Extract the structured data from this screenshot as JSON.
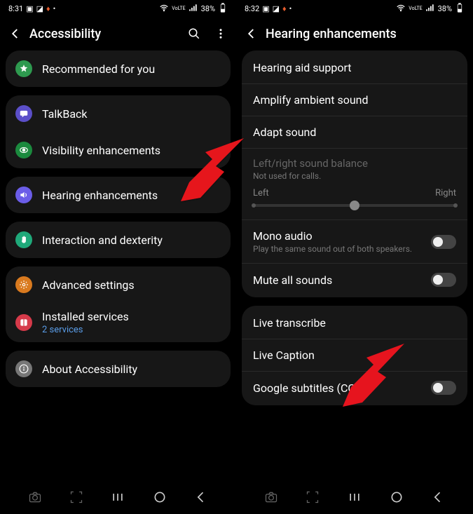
{
  "left": {
    "status": {
      "time": "8:31",
      "battery": "38%"
    },
    "title": "Accessibility",
    "groups": [
      [
        {
          "icon": "star",
          "color": "#2e9a4f",
          "label": "Recommended for you"
        }
      ],
      [
        {
          "icon": "chat",
          "color": "#5b4fc9",
          "label": "TalkBack"
        },
        {
          "icon": "eye",
          "color": "#1b8a3e",
          "label": "Visibility enhancements"
        }
      ],
      [
        {
          "icon": "speaker",
          "color": "#6b5de8",
          "label": "Hearing enhancements"
        }
      ],
      [
        {
          "icon": "hand",
          "color": "#1fa97a",
          "label": "Interaction and dexterity"
        }
      ],
      [
        {
          "icon": "gear",
          "color": "#d97a1f",
          "label": "Advanced settings"
        },
        {
          "icon": "box",
          "color": "#d63a4a",
          "label": "Installed services",
          "sub": "2 services"
        }
      ],
      [
        {
          "icon": "info",
          "color": "#777",
          "label": "About Accessibility"
        }
      ]
    ]
  },
  "right": {
    "status": {
      "time": "8:32",
      "battery": "38%"
    },
    "title": "Hearing enhancements",
    "card1": {
      "items": [
        {
          "label": "Hearing aid support"
        },
        {
          "label": "Amplify ambient sound"
        },
        {
          "label": "Adapt sound"
        }
      ],
      "balance": {
        "title": "Left/right sound balance",
        "sub": "Not used for calls.",
        "left": "Left",
        "right": "Right"
      },
      "mono": {
        "label": "Mono audio",
        "sub": "Play the same sound out of both speakers."
      },
      "mute": {
        "label": "Mute all sounds"
      }
    },
    "card2": {
      "items": [
        {
          "label": "Live transcribe"
        },
        {
          "label": "Live Caption"
        },
        {
          "label": "Google subtitles (CC)",
          "toggle": true
        }
      ]
    }
  }
}
